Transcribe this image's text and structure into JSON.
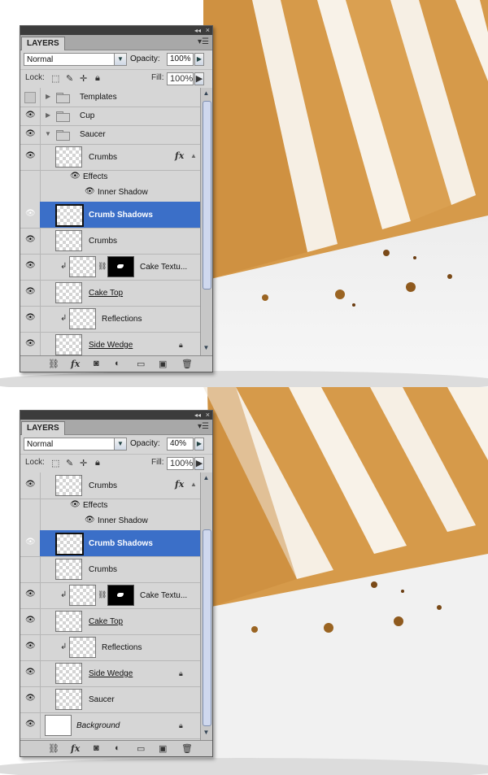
{
  "panels": [
    {
      "tab": "LAYERS",
      "blend_mode": "Normal",
      "opacity_label": "Opacity:",
      "opacity": "100%",
      "lock_label": "Lock:",
      "fill_label": "Fill:",
      "fill": "100%",
      "layers": [
        {
          "name": "Templates",
          "type": "group",
          "visible": false
        },
        {
          "name": "Cup",
          "type": "group",
          "visible": true
        },
        {
          "name": "Saucer",
          "type": "group",
          "visible": true,
          "expanded": true
        },
        {
          "name": "Crumbs",
          "type": "layer",
          "fx": "fx",
          "visible": true
        },
        {
          "name": "Effects",
          "type": "effects"
        },
        {
          "name": "Inner Shadow",
          "type": "effect"
        },
        {
          "name": "Crumb Shadows",
          "type": "layer",
          "selected": true,
          "visible": true
        },
        {
          "name": "Crumbs",
          "type": "layer",
          "visible": true
        },
        {
          "name": "Cake Textu...",
          "type": "layer-mask",
          "clipped": true,
          "visible": true
        },
        {
          "name": "Cake Top",
          "type": "smart",
          "visible": true
        },
        {
          "name": "Reflections",
          "type": "layer",
          "clipped": true,
          "visible": true
        },
        {
          "name": "Side Wedge",
          "type": "layer",
          "locked": true,
          "visible": true
        }
      ]
    },
    {
      "tab": "LAYERS",
      "blend_mode": "Normal",
      "opacity_label": "Opacity:",
      "opacity": "40%",
      "lock_label": "Lock:",
      "fill_label": "Fill:",
      "fill": "100%",
      "layers": [
        {
          "name": "Crumbs",
          "type": "layer",
          "fx": "fx",
          "visible": true
        },
        {
          "name": "Effects",
          "type": "effects"
        },
        {
          "name": "Inner Shadow",
          "type": "effect"
        },
        {
          "name": "Crumb Shadows",
          "type": "layer",
          "selected": true,
          "visible": true
        },
        {
          "name": "Crumbs",
          "type": "layer",
          "visible": true
        },
        {
          "name": "Cake Textu...",
          "type": "layer-mask",
          "clipped": true,
          "visible": true
        },
        {
          "name": "Cake Top",
          "type": "smart",
          "visible": true
        },
        {
          "name": "Reflections",
          "type": "layer",
          "clipped": true,
          "visible": true
        },
        {
          "name": "Side Wedge",
          "type": "layer",
          "locked": true,
          "visible": true
        },
        {
          "name": "Saucer",
          "type": "layer",
          "visible": true
        },
        {
          "name": "Background",
          "type": "background",
          "locked": true,
          "visible": true
        }
      ]
    }
  ],
  "icons": {
    "eye": "eye-icon",
    "folder": "folder-icon",
    "lock": "lock-icon",
    "link": "link-icon",
    "fx": "fx-icon",
    "mask": "add-mask-icon",
    "adjust": "adjustment-layer-icon",
    "new_group": "new-group-icon",
    "new_layer": "new-layer-icon",
    "trash": "trash-icon"
  },
  "colors": {
    "selection": "#3b6fc8",
    "panel_bg": "#d6d6d6",
    "cake": "#d69a4a",
    "frosting": "#f6efe4"
  }
}
